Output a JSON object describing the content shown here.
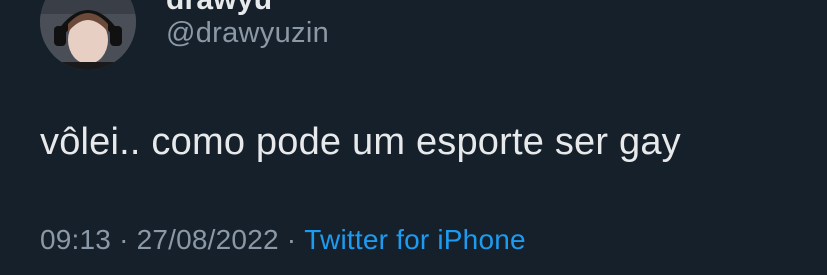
{
  "tweet": {
    "author": {
      "display_name": "drawyu",
      "handle": "@drawyuzin",
      "avatar_icon": "user-avatar-photo"
    },
    "text": "vôlei.. como pode um esporte ser gay",
    "meta": {
      "time": "09:13",
      "separator": "·",
      "date": "27/08/2022",
      "source": "Twitter for iPhone"
    }
  },
  "colors": {
    "background": "#15202b",
    "primary_text": "#e7e9ea",
    "secondary_text": "#8b98a5",
    "accent": "#1d9bf0"
  }
}
